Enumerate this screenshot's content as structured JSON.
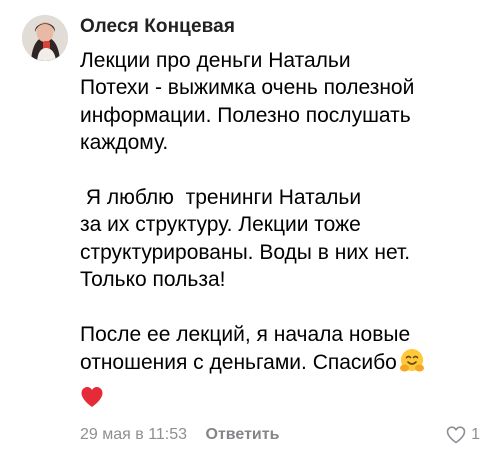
{
  "comment": {
    "author": "Олеся Концевая",
    "paragraphs": [
      "Лекции про деньги Натальи\nПотехи - выжимка очень полезной\nинформации. Полезно послушать\nкаждому.",
      " Я люблю  тренинги Натальи\nза их структуру. Лекции тоже\nструктурированы. Воды в них нет.\nТолько польза!",
      "После ее лекций, я начала новые\nотношения с деньгами. Спасибо"
    ],
    "emojis": [
      "hugging-face",
      "red-heart"
    ],
    "date": "29 мая в 11:53",
    "reply_label": "Ответить",
    "like_count": "1",
    "icons": [
      "avatar",
      "heart-outline-icon"
    ],
    "colors": {
      "meta_text": "#8d8f94",
      "heart_red": "#e52b37"
    }
  }
}
